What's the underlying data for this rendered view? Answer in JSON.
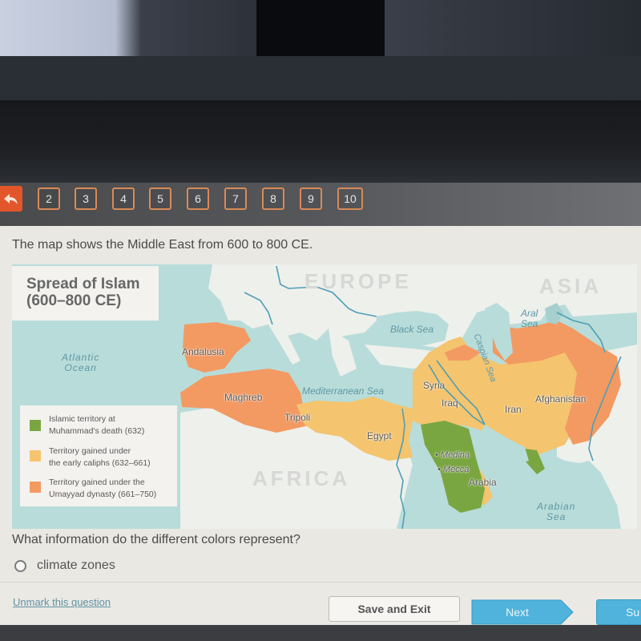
{
  "navigation": {
    "back_icon": "undo-arrow-icon",
    "question_numbers": [
      "2",
      "3",
      "4",
      "5",
      "6",
      "7",
      "8",
      "9",
      "10"
    ]
  },
  "prompt": "The map shows the Middle East from 600 to 800 CE.",
  "map": {
    "title_line1": "Spread of Islam",
    "title_line2": "(600–800 CE)",
    "continents": {
      "europe": "EUROPE",
      "asia": "ASIA",
      "africa": "AFRICA"
    },
    "water_bodies": {
      "atlantic_line1": "Atlantic",
      "atlantic_line2": "Ocean",
      "mediterranean": "Mediterranean Sea",
      "black_sea": "Black Sea",
      "caspian": "Caspian Sea",
      "aral_line1": "Aral",
      "aral_line2": "Sea",
      "arabian_line1": "Arabian",
      "arabian_line2": "Sea"
    },
    "regions": {
      "andalusia": "Andalusia",
      "maghreb": "Maghreb",
      "tripoli": "Tripoli",
      "egypt": "Egypt",
      "syria": "Syria",
      "iraq": "Iraq",
      "iran": "Iran",
      "afghanistan": "Afghanistan",
      "arabia": "Arabia",
      "medina": "Medina",
      "mecca": "Mecca"
    },
    "legend": [
      {
        "color": "#7aa642",
        "line1": "Islamic territory at",
        "line2": "Muhammad's death (632)"
      },
      {
        "color": "#f4c46e",
        "line1": "Territory gained under",
        "line2": "the early caliphs (632–661)"
      },
      {
        "color": "#f29a62",
        "line1": "Territory gained under the",
        "line2": "Umayyad dynasty (661–750)"
      }
    ],
    "colors": {
      "water": "#b8dcd9",
      "land": "#eef0ec",
      "muhammad": "#7aa642",
      "early_caliphs": "#f4c46e",
      "umayyad": "#f29a62",
      "river": "#4e9fb4"
    }
  },
  "question": "What information do the different colors represent?",
  "options": [
    {
      "label": "climate zones",
      "selected": false
    }
  ],
  "footer": {
    "unmark": "Unmark this question",
    "save_exit": "Save and Exit",
    "next": "Next",
    "submit": "Su"
  }
}
